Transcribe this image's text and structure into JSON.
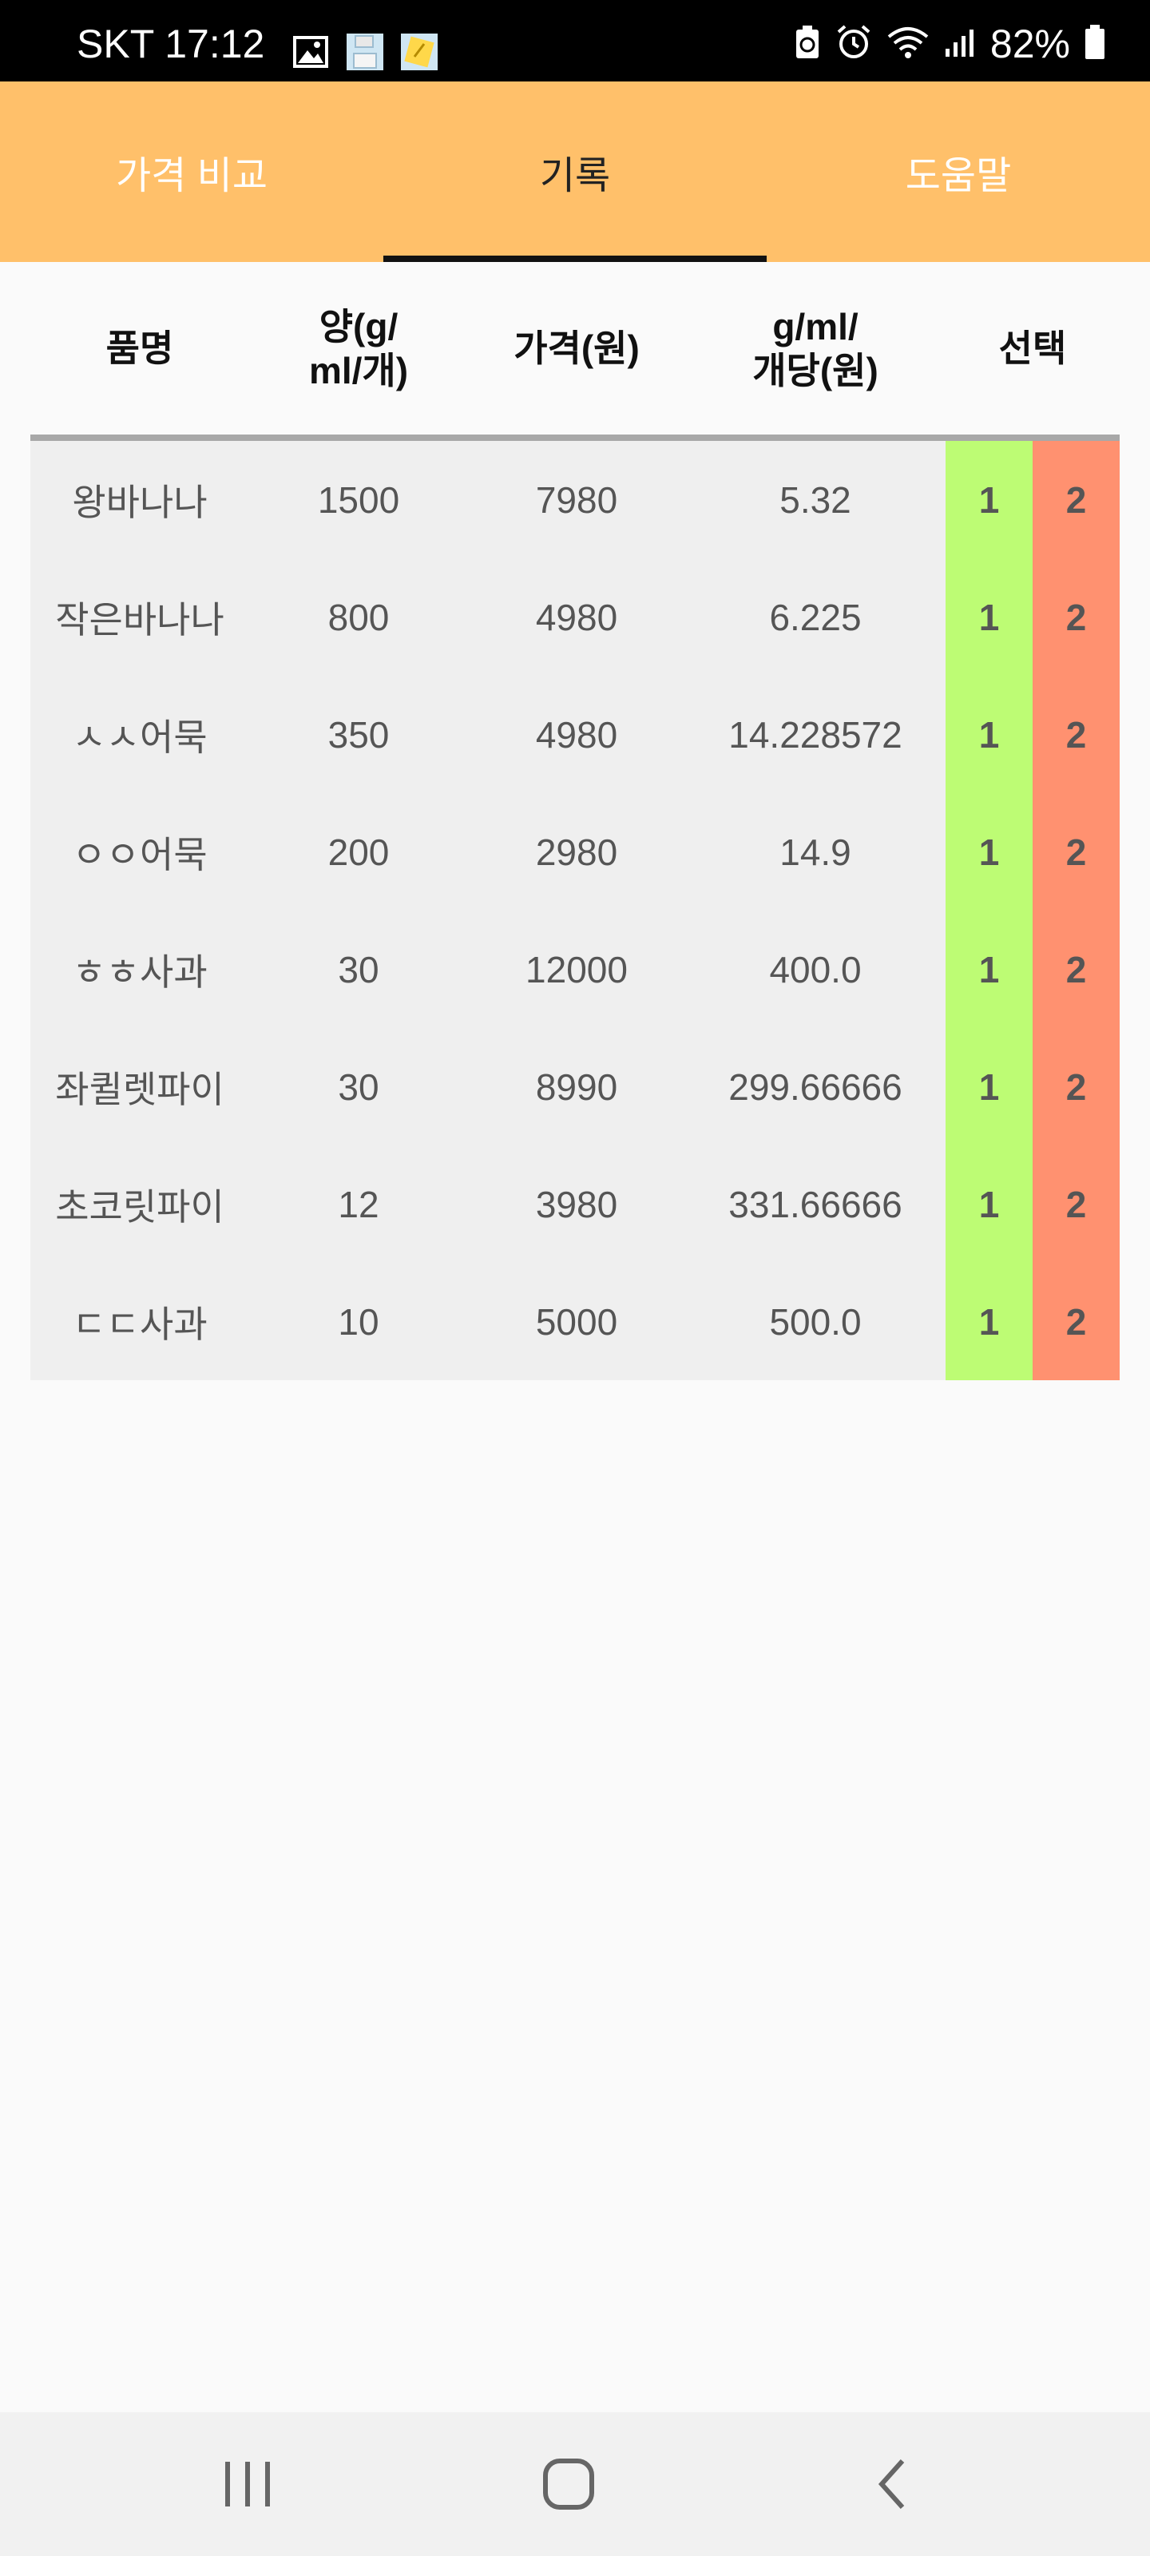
{
  "status_bar": {
    "carrier_time": "SKT 17:12",
    "battery": "82%",
    "icons": [
      "image-icon",
      "save-icon",
      "memo-icon",
      "battery-saver-icon",
      "alarm-icon",
      "wifi-icon",
      "signal-icon",
      "battery-icon"
    ]
  },
  "tabs": [
    {
      "label": "가격 비교",
      "active": false
    },
    {
      "label": "기록",
      "active": true
    },
    {
      "label": "도움말",
      "active": false
    }
  ],
  "table": {
    "headers": {
      "name": "품명",
      "qty": "양(g/\nml/개)",
      "price": "가격(원)",
      "unit_price": "g/ml/\n개당(원)",
      "select": "선택"
    },
    "rows": [
      {
        "name": "왕바나나",
        "qty": "1500",
        "price": "7980",
        "unit_price": "5.32",
        "btn1": "1",
        "btn2": "2"
      },
      {
        "name": "작은바나나",
        "qty": "800",
        "price": "4980",
        "unit_price": "6.225",
        "btn1": "1",
        "btn2": "2"
      },
      {
        "name": "ㅅㅅ어묵",
        "qty": "350",
        "price": "4980",
        "unit_price": "14.228572",
        "btn1": "1",
        "btn2": "2"
      },
      {
        "name": "ㅇㅇ어묵",
        "qty": "200",
        "price": "2980",
        "unit_price": "14.9",
        "btn1": "1",
        "btn2": "2"
      },
      {
        "name": "ㅎㅎ사과",
        "qty": "30",
        "price": "12000",
        "unit_price": "400.0",
        "btn1": "1",
        "btn2": "2"
      },
      {
        "name": "좌퀼렛파이",
        "qty": "30",
        "price": "8990",
        "unit_price": "299.66666",
        "btn1": "1",
        "btn2": "2"
      },
      {
        "name": "초코릿파이",
        "qty": "12",
        "price": "3980",
        "unit_price": "331.66666",
        "btn1": "1",
        "btn2": "2"
      },
      {
        "name": "ㄷㄷ사과",
        "qty": "10",
        "price": "5000",
        "unit_price": "500.0",
        "btn1": "1",
        "btn2": "2"
      }
    ]
  },
  "nav_bar": {
    "buttons": [
      "recent-apps-icon",
      "home-icon",
      "back-icon"
    ]
  },
  "colors": {
    "tab_bar": "#ffc06a",
    "select_1": "#bdfc74",
    "select_2": "#ff9170",
    "table_bg": "#efefef"
  }
}
